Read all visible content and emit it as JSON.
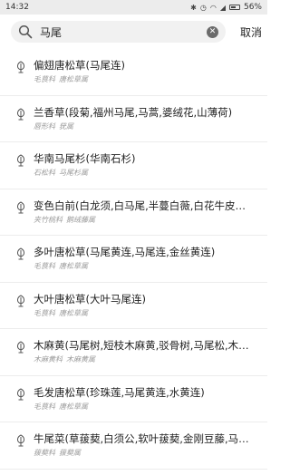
{
  "status": {
    "time": "14:32",
    "battery": "56%",
    "icons": [
      "bluetooth-icon",
      "alarm-icon",
      "wifi-icon",
      "signal-icon",
      "battery-icon"
    ]
  },
  "search": {
    "query": "马尾",
    "cancel_label": "取消"
  },
  "results": [
    {
      "title": "偏翅唐松草(马尾连)",
      "family": "毛茛科",
      "genus": "唐松草属"
    },
    {
      "title": "兰香草(段菊,福州马尾,马蒿,婆绒花,山薄荷)",
      "family": "唇形科",
      "genus": "莸属"
    },
    {
      "title": "华南马尾杉(华南石杉)",
      "family": "石松科",
      "genus": "马尾杉属"
    },
    {
      "title": "变色白前(白龙须,白马尾,半蔓白薇,白花牛皮…",
      "family": "夹竹桃科",
      "genus": "鹅绒藤属"
    },
    {
      "title": "多叶唐松草(马尾黄连,马尾连,金丝黄连)",
      "family": "毛茛科",
      "genus": "唐松草属"
    },
    {
      "title": "大叶唐松草(大叶马尾连)",
      "family": "毛茛科",
      "genus": "唐松草属"
    },
    {
      "title": "木麻黄(马尾树,短枝木麻黄,驳骨树,马尾松,木…",
      "family": "木麻黄科",
      "genus": "木麻黄属"
    },
    {
      "title": "毛发唐松草(珍珠莲,马尾黄连,水黄连)",
      "family": "毛茛科",
      "genus": "唐松草属"
    },
    {
      "title": "牛尾菜(草菝葜,白须公,软叶菝葜,金刚豆藤,马…",
      "family": "菝葜科",
      "genus": "菝葜属"
    }
  ]
}
